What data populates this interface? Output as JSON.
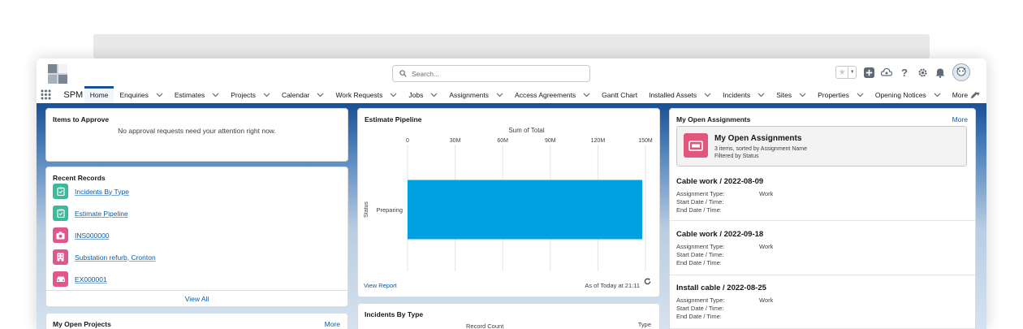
{
  "search": {
    "placeholder": "Search..."
  },
  "nav": {
    "app_name": "SPM",
    "items": [
      {
        "label": "Home"
      },
      {
        "label": "Enquiries"
      },
      {
        "label": "Estimates"
      },
      {
        "label": "Projects"
      },
      {
        "label": "Calendar"
      },
      {
        "label": "Work Requests"
      },
      {
        "label": "Jobs"
      },
      {
        "label": "Assignments"
      },
      {
        "label": "Access Agreements"
      },
      {
        "label": "Gantt Chart"
      },
      {
        "label": "Installed Assets"
      },
      {
        "label": "Incidents"
      },
      {
        "label": "Sites"
      },
      {
        "label": "Properties"
      },
      {
        "label": "Opening Notices"
      },
      {
        "label": "More"
      }
    ]
  },
  "items_to_approve": {
    "title": "Items to Approve",
    "empty_message": "No approval requests need your attention right now."
  },
  "recent_records": {
    "title": "Recent Records",
    "items": [
      {
        "label": "Incidents By Type",
        "icon": "report-icon",
        "color": "#3bba9c"
      },
      {
        "label": "Estimate Pipeline",
        "icon": "report-icon",
        "color": "#3bba9c"
      },
      {
        "label": "INS000000",
        "icon": "inspection-icon",
        "color": "#e1568c"
      },
      {
        "label": "Substation refurb, Cronton",
        "icon": "building-icon",
        "color": "#e1568c"
      },
      {
        "label": "EX000001",
        "icon": "car-icon",
        "color": "#e1568c"
      }
    ],
    "view_all": "View All"
  },
  "my_open_projects": {
    "title": "My Open Projects",
    "more": "More"
  },
  "estimate_pipeline": {
    "title": "Estimate Pipeline",
    "view_report": "View Report",
    "timestamp": "As of Today at 21:11"
  },
  "incidents_by_type": {
    "title": "Incidents By Type",
    "axis_label": "Record Count",
    "legend_label": "Type"
  },
  "chart_data": {
    "type": "bar",
    "orientation": "horizontal",
    "title": "Sum of Total",
    "xlabel": "Sum of Total",
    "ylabel": "Status",
    "categories": [
      "Preparing"
    ],
    "values": [
      148000000
    ],
    "xlim": [
      0,
      150000000
    ],
    "ticks": [
      {
        "value": 0,
        "label": "0"
      },
      {
        "value": 30000000,
        "label": "30M"
      },
      {
        "value": 60000000,
        "label": "60M"
      },
      {
        "value": 90000000,
        "label": "90M"
      },
      {
        "value": 120000000,
        "label": "120M"
      },
      {
        "value": 150000000,
        "label": "150M"
      }
    ],
    "color": "#00a1e0",
    "grid": true
  },
  "my_open_assignments": {
    "title": "My Open Assignments",
    "more": "More",
    "list_title": "My Open Assignments",
    "list_sub1": "3 items, sorted by Assignment Name",
    "list_sub2": "Filtered by Status",
    "field_type": "Assignment Type:",
    "field_start": "Start Date / Time:",
    "field_end": "End Date / Time:",
    "items": [
      {
        "title": "Cable work / 2022-08-09",
        "type": "Work"
      },
      {
        "title": "Cable work / 2022-09-18",
        "type": "Work"
      },
      {
        "title": "Install cable / 2022-08-25",
        "type": "Work"
      }
    ]
  }
}
